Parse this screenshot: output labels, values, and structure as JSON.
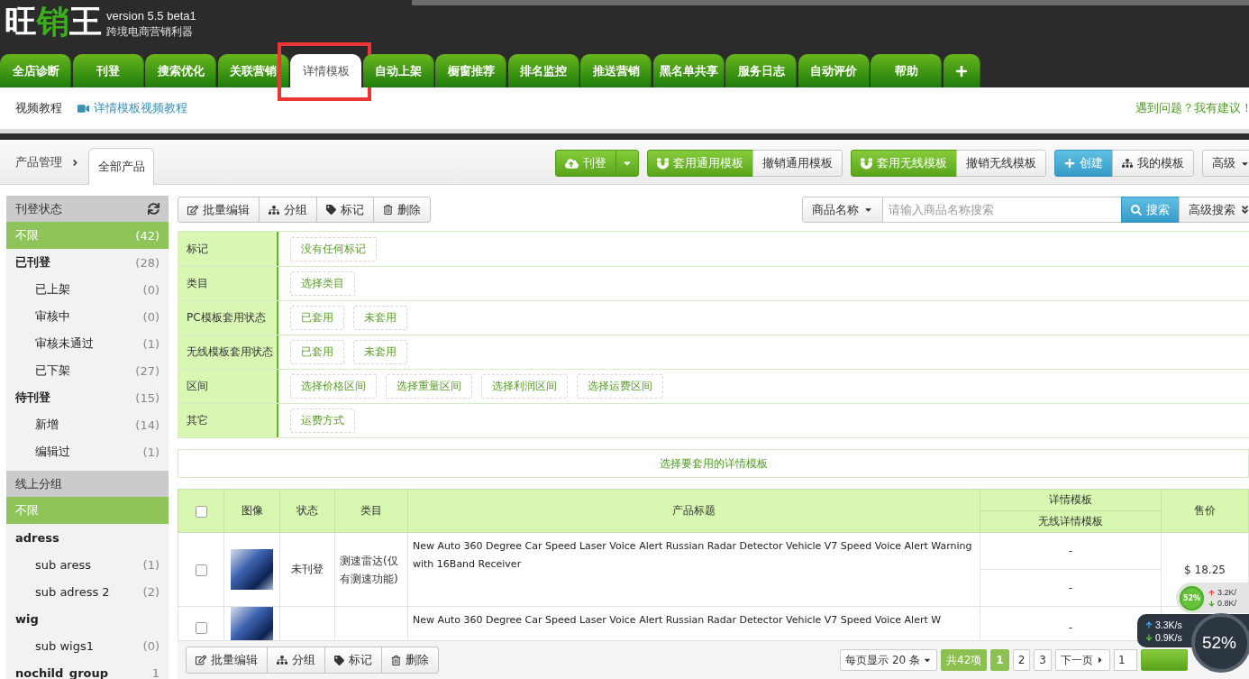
{
  "header": {
    "logo": [
      {
        "text": "旺",
        "accent": false
      },
      {
        "text": "销",
        "accent": true
      },
      {
        "text": "王",
        "accent": false
      }
    ],
    "version": "version 5.5 beta1",
    "slogan": "跨境电商营销利器"
  },
  "main_tabs": [
    {
      "kind": "text",
      "label": "全店诊断",
      "selected": false,
      "highlighted": false
    },
    {
      "kind": "text",
      "label": "刊登",
      "selected": false,
      "highlighted": false
    },
    {
      "kind": "text",
      "label": "搜索优化",
      "selected": false,
      "highlighted": false
    },
    {
      "kind": "text",
      "label": "关联营销",
      "selected": false,
      "highlighted": false
    },
    {
      "kind": "text",
      "label": "详情模板",
      "selected": true,
      "highlighted": true
    },
    {
      "kind": "text",
      "label": "自动上架",
      "selected": false,
      "highlighted": false
    },
    {
      "kind": "text",
      "label": "橱窗推荐",
      "selected": false,
      "highlighted": false
    },
    {
      "kind": "text",
      "label": "排名监控",
      "selected": false,
      "highlighted": false
    },
    {
      "kind": "text",
      "label": "推送营销",
      "selected": false,
      "highlighted": false
    },
    {
      "kind": "text",
      "label": "黑名单共享",
      "selected": false,
      "highlighted": false
    },
    {
      "kind": "text",
      "label": "服务日志",
      "selected": false,
      "highlighted": false
    },
    {
      "kind": "text",
      "label": "自动评价",
      "selected": false,
      "highlighted": false
    },
    {
      "kind": "text",
      "label": "帮助",
      "selected": false,
      "highlighted": false
    },
    {
      "kind": "add",
      "selected": false,
      "highlighted": false
    }
  ],
  "subnav": {
    "links": [
      {
        "kind": "plain",
        "label": "视频教程"
      },
      {
        "kind": "video",
        "label": "详情模板视频教程"
      }
    ],
    "feedback": "遇到问题？我有建议！"
  },
  "page_header": {
    "breadcrumb": "产品管理",
    "tab": "全部产品",
    "action_groups": [
      {
        "buttons": [
          {
            "kind": "upload",
            "label": "刊登"
          },
          {
            "kind": "dropdown"
          }
        ]
      },
      {
        "buttons": [
          {
            "kind": "apply",
            "label": "套用通用模板"
          },
          {
            "kind": "plain",
            "label": "撤销通用模板"
          }
        ]
      },
      {
        "buttons": [
          {
            "kind": "apply",
            "label": "套用无线模板"
          },
          {
            "kind": "plain",
            "label": "撤销无线模板"
          }
        ]
      },
      {
        "buttons": [
          {
            "kind": "create",
            "label": "创建"
          },
          {
            "kind": "tree",
            "label": "我的模板"
          }
        ]
      },
      {
        "buttons": [
          {
            "kind": "menu",
            "label": "高级"
          }
        ]
      }
    ]
  },
  "sidebar": {
    "sections": [
      {
        "title": "刊登状态",
        "refresh": true,
        "items": [
          {
            "kind": "all",
            "label": "不限",
            "count": "(42)",
            "selected": true
          },
          {
            "kind": "group",
            "label": "已刊登",
            "count": "(28)",
            "selected": false,
            "children": [
              {
                "label": "已上架",
                "count": "(0)",
                "selected": false
              },
              {
                "label": "审核中",
                "count": "(0)",
                "selected": false
              },
              {
                "label": "审核未通过",
                "count": "(1)",
                "selected": false
              },
              {
                "label": "已下架",
                "count": "(27)",
                "selected": false
              }
            ]
          },
          {
            "kind": "group",
            "label": "待刊登",
            "count": "(15)",
            "selected": false,
            "children": [
              {
                "label": "新增",
                "count": "(14)",
                "selected": false
              },
              {
                "label": "编辑过",
                "count": "(1)",
                "selected": false
              }
            ]
          }
        ]
      },
      {
        "title": "线上分组",
        "refresh": false,
        "items": [
          {
            "kind": "all",
            "label": "不限",
            "selected": true
          },
          {
            "kind": "group",
            "label": "adress",
            "selected": false,
            "children": [
              {
                "label": "sub aress",
                "count": "(1)",
                "selected": false
              },
              {
                "label": "sub adress 2",
                "count": "(2)",
                "selected": false
              }
            ]
          },
          {
            "kind": "group",
            "label": "wig",
            "selected": false,
            "children": [
              {
                "label": "sub wigs1",
                "count": "(0)",
                "selected": false
              }
            ]
          },
          {
            "kind": "group",
            "label": "nochild_group",
            "count": "1",
            "selected": false
          }
        ]
      }
    ]
  },
  "toolbar": {
    "bulk_actions": [
      {
        "kind": "edit",
        "label": "批量编辑"
      },
      {
        "kind": "group",
        "label": "分组"
      },
      {
        "kind": "tag",
        "label": "标记"
      },
      {
        "kind": "delete",
        "label": "删除"
      }
    ],
    "search": {
      "field": "商品名称",
      "placeholder": "请输入商品名称搜索",
      "button": "搜索",
      "advanced": "高级搜索"
    }
  },
  "filters": [
    {
      "label": "标记",
      "options": [
        "没有任何标记"
      ]
    },
    {
      "label": "类目",
      "options": [
        "选择类目"
      ]
    },
    {
      "label": "PC模板套用状态",
      "options": [
        "已套用",
        "未套用"
      ]
    },
    {
      "label": "无线模板套用状态",
      "options": [
        "已套用",
        "未套用"
      ]
    },
    {
      "label": "区间",
      "options": [
        "选择价格区间",
        "选择重量区间",
        "选择利润区间",
        "选择运费区间"
      ]
    },
    {
      "label": "其它",
      "options": [
        "运费方式"
      ]
    }
  ],
  "template_picker": "选择要套用的详情模板",
  "table": {
    "select_all": {
      "checked": false
    },
    "columns": [
      {
        "label": "图像"
      },
      {
        "label": "状态"
      },
      {
        "label": "类目"
      },
      {
        "label": "产品标题"
      },
      {
        "label": "详情模板",
        "sub": "无线详情模板"
      },
      {
        "label": "售价"
      }
    ],
    "rows": [
      {
        "checked": false,
        "status": "未刊登",
        "category": "测速雷达(仅有测速功能)",
        "title": "New Auto 360 Degree Car Speed Laser Voice Alert Russian Radar Detector Vehicle V7 Speed Voice Alert Warning with 16Band Receiver",
        "templates": [
          "-",
          "-"
        ],
        "price": "$ 18.25"
      },
      {
        "checked": false,
        "title": "New Auto 360 Degree Car Speed Laser Voice Alert Russian Radar Detector Vehicle V7 Speed Voice Alert W",
        "templates": [
          "-"
        ]
      }
    ]
  },
  "footer": {
    "bulk_actions": [
      {
        "kind": "edit",
        "label": "批量编辑"
      },
      {
        "kind": "group",
        "label": "分组"
      },
      {
        "kind": "tag",
        "label": "标记"
      },
      {
        "kind": "delete",
        "label": "删除"
      }
    ],
    "pagination": {
      "page_size": "每页显示 20 条",
      "total": "共42项",
      "pages": [
        {
          "label": "1",
          "selected": true
        },
        {
          "label": "2",
          "selected": false
        },
        {
          "label": "3",
          "selected": false
        }
      ],
      "next": "下一页",
      "jump_value": "1"
    }
  },
  "speed_widget": {
    "mini": {
      "percent": "52%",
      "up": "3.2K/",
      "down": "0.8K/"
    },
    "panel": {
      "up": "3.3K/s",
      "down": "0.9K/s",
      "percent": "52%"
    }
  }
}
